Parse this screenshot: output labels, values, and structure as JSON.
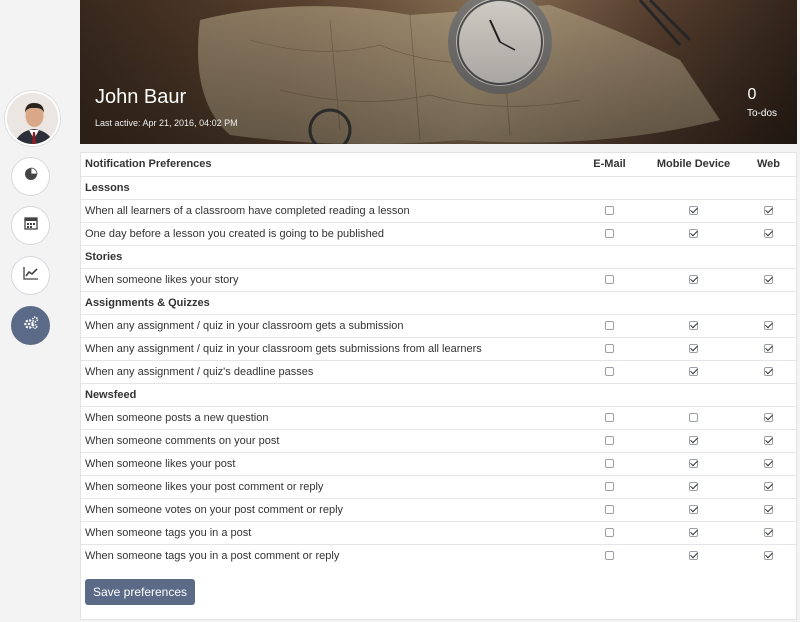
{
  "profile": {
    "name": "John Baur",
    "last_active": "Last active: Apr 21, 2016, 04:02 PM",
    "todo_count": "0",
    "todo_label": "To-dos"
  },
  "sidebar": {
    "items": [
      {
        "name": "stats",
        "icon": "pie-chart-icon",
        "active": false
      },
      {
        "name": "calendar",
        "icon": "calendar-icon",
        "active": false
      },
      {
        "name": "progress",
        "icon": "line-chart-icon",
        "active": false
      },
      {
        "name": "settings",
        "icon": "gears-icon",
        "active": true
      }
    ]
  },
  "table": {
    "header": {
      "label": "Notification Preferences",
      "email": "E-Mail",
      "mobile": "Mobile Device",
      "web": "Web"
    },
    "sections": [
      {
        "title": "Lessons",
        "rows": [
          {
            "label": "When all learners of a classroom have completed reading a lesson",
            "email": false,
            "mobile": true,
            "web": true
          },
          {
            "label": "One day before a lesson you created is going to be published",
            "email": false,
            "mobile": true,
            "web": true
          }
        ]
      },
      {
        "title": "Stories",
        "rows": [
          {
            "label": "When someone likes your story",
            "email": false,
            "mobile": true,
            "web": true
          }
        ]
      },
      {
        "title": "Assignments & Quizzes",
        "rows": [
          {
            "label": "When any assignment / quiz in your classroom gets a submission",
            "email": false,
            "mobile": true,
            "web": true
          },
          {
            "label": "When any assignment / quiz in your classroom gets submissions from all learners",
            "email": false,
            "mobile": true,
            "web": true
          },
          {
            "label": "When any assignment / quiz's deadline passes",
            "email": false,
            "mobile": true,
            "web": true
          }
        ]
      },
      {
        "title": "Newsfeed",
        "rows": [
          {
            "label": "When someone posts a new question",
            "email": false,
            "mobile": false,
            "web": true
          },
          {
            "label": "When someone comments on your post",
            "email": false,
            "mobile": true,
            "web": true
          },
          {
            "label": "When someone likes your post",
            "email": false,
            "mobile": true,
            "web": true
          },
          {
            "label": "When someone likes your post comment or reply",
            "email": false,
            "mobile": true,
            "web": true
          },
          {
            "label": "When someone votes on your post comment or reply",
            "email": false,
            "mobile": true,
            "web": true
          },
          {
            "label": "When someone tags you in a post",
            "email": false,
            "mobile": true,
            "web": true
          },
          {
            "label": "When someone tags you in a post comment or reply",
            "email": false,
            "mobile": true,
            "web": true
          }
        ]
      }
    ]
  },
  "save_label": "Save preferences"
}
